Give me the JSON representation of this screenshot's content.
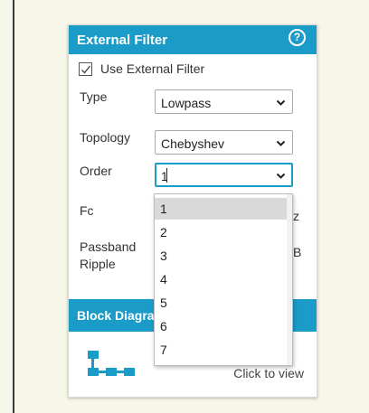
{
  "panel": {
    "title": "External Filter",
    "help_icon": "?",
    "use_external_filter_label": "Use External Filter",
    "use_external_filter_checked": true,
    "type": {
      "label": "Type",
      "value": "Lowpass"
    },
    "topology": {
      "label": "Topology",
      "value": "Chebyshev"
    },
    "order": {
      "label": "Order",
      "value": "1"
    },
    "fc": {
      "label": "Fc",
      "unit_visible": "z"
    },
    "passband_ripple": {
      "label_line1": "Passband",
      "label_line2": "Ripple",
      "unit_visible": "B"
    }
  },
  "block_diagram": {
    "title": "Block Diagram",
    "click_label": "Click to view"
  },
  "order_dropdown": {
    "options": [
      "1",
      "2",
      "3",
      "4",
      "5",
      "6",
      "7"
    ],
    "selected_index": 0
  },
  "colors": {
    "accent": "#1b9bc8",
    "page_background": "#f7f7e9",
    "selected_option": "#d9d9d9"
  }
}
